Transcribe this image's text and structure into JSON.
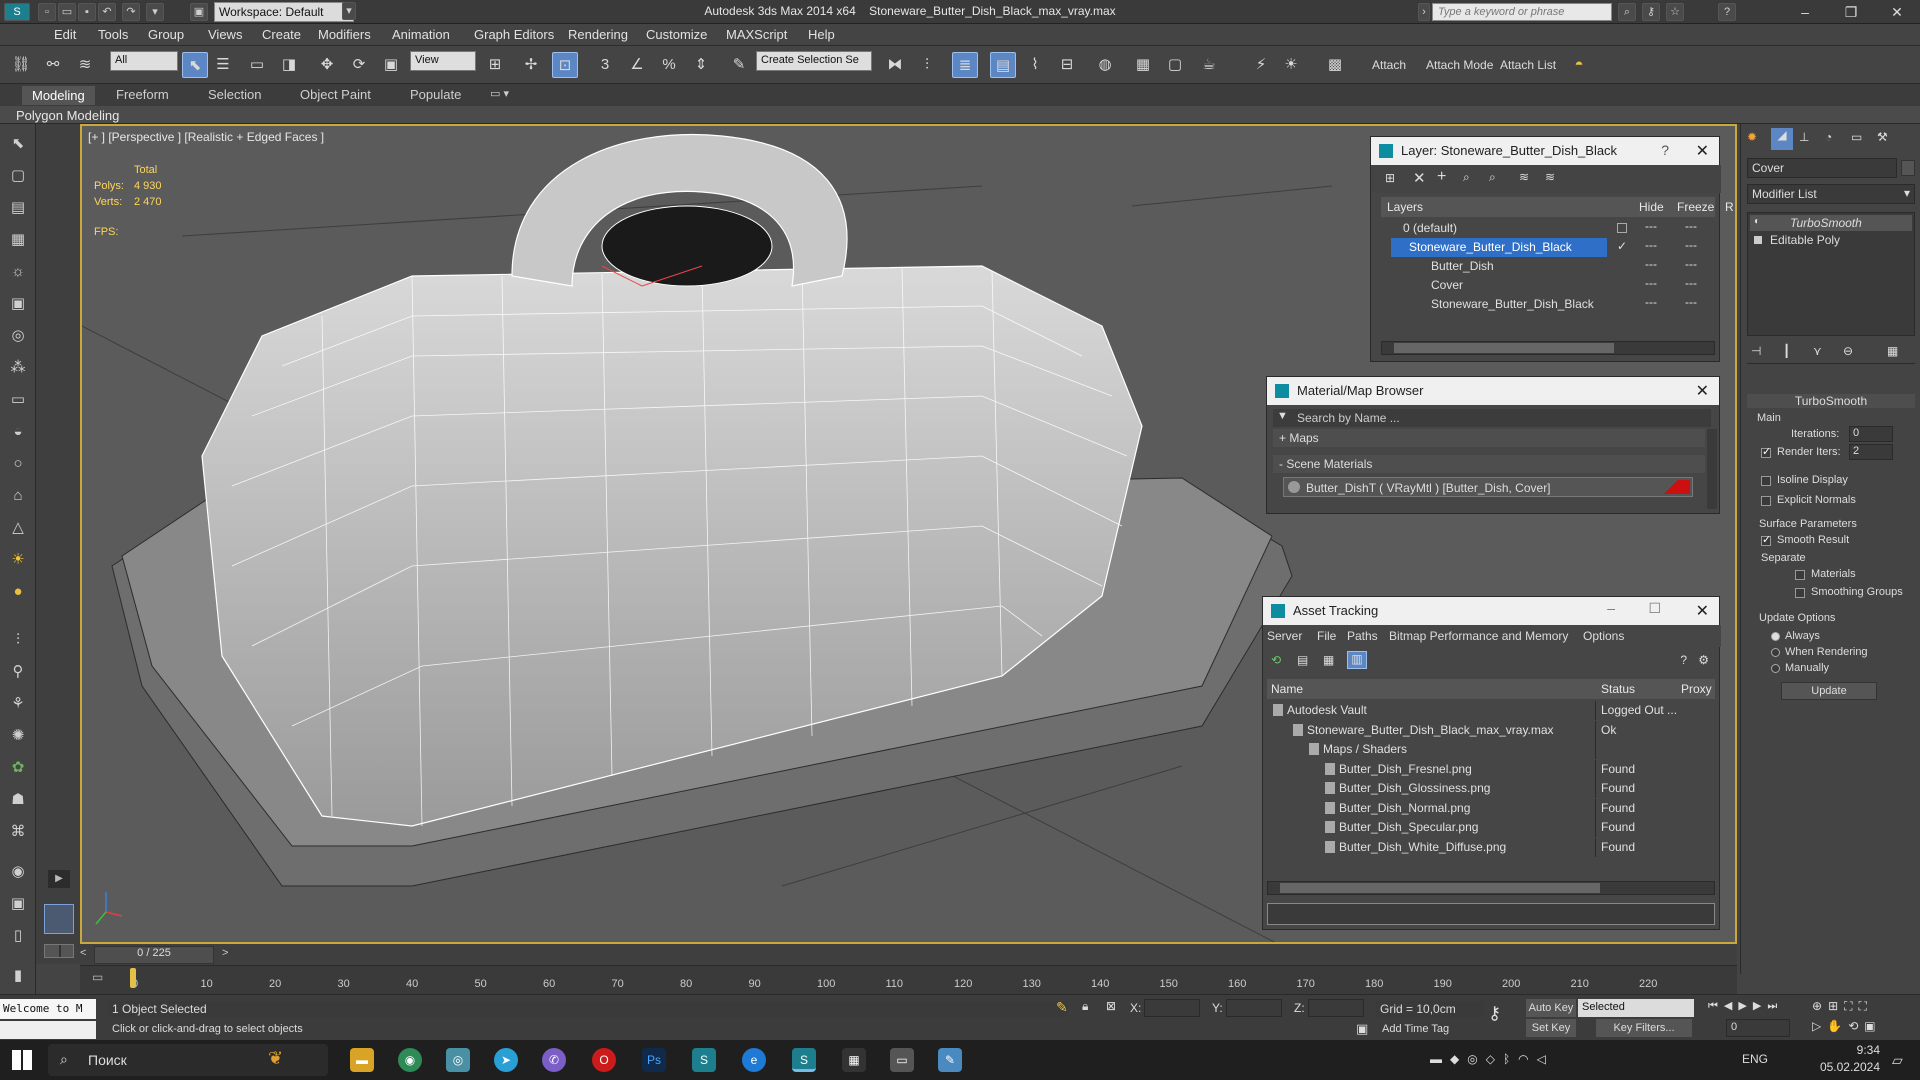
{
  "window": {
    "app_title": "Autodesk 3ds Max  2014 x64",
    "file_title": "Stoneware_Butter_Dish_Black_max_vray.max",
    "workspace": "Workspace: Default",
    "search_placeholder": "Type a keyword or phrase"
  },
  "menu": [
    "Edit",
    "Tools",
    "Group",
    "Views",
    "Create",
    "Modifiers",
    "Animation",
    "Graph Editors",
    "Rendering",
    "Customize",
    "MAXScript",
    "Help"
  ],
  "toolbar": {
    "selection_filter": "All",
    "ref_coord": "View",
    "named_selection": "Create Selection Se",
    "attach_label": "Attach",
    "attach_mode_label": "Attach Mode",
    "attach_list_label": "Attach List"
  },
  "ribbon": {
    "tabs": [
      "Modeling",
      "Freeform",
      "Selection",
      "Object Paint",
      "Populate"
    ],
    "subtitle": "Polygon Modeling"
  },
  "viewport": {
    "label": "[+ ] [Perspective ] [Realistic + Edged Faces ]",
    "stats_total": "Total",
    "polys_label": "Polys:",
    "polys_value": "4 930",
    "verts_label": "Verts:",
    "verts_value": "2 470",
    "fps_label": "FPS:"
  },
  "layer_panel": {
    "title": "Layer: Stoneware_Butter_Dish_Black",
    "col_layers": "Layers",
    "col_hide": "Hide",
    "col_freeze": "Freeze",
    "col_r": "R",
    "rows": [
      "0 (default)",
      "Stoneware_Butter_Dish_Black",
      "Butter_Dish",
      "Cover",
      "Stoneware_Butter_Dish_Black"
    ]
  },
  "material_browser": {
    "title": "Material/Map Browser",
    "search_placeholder": "Search by Name ...",
    "maps_label": "+ Maps",
    "scene_materials_label": "- Scene Materials",
    "material_item": "Butter_DishT  ( VRayMtl )  [Butter_Dish, Cover]",
    "swatch_color": "#cc1010"
  },
  "asset_tracking": {
    "title": "Asset Tracking",
    "menu": [
      "Server",
      "File",
      "Paths",
      "Bitmap Performance and Memory",
      "Options"
    ],
    "col_name": "Name",
    "col_status": "Status",
    "col_proxy": "Proxy",
    "rows": [
      {
        "name": "Autodesk Vault",
        "status": "Logged Out ..."
      },
      {
        "name": "Stoneware_Butter_Dish_Black_max_vray.max",
        "status": "Ok"
      },
      {
        "name": "Maps / Shaders",
        "status": ""
      },
      {
        "name": "Butter_Dish_Fresnel.png",
        "status": "Found"
      },
      {
        "name": "Butter_Dish_Glossiness.png",
        "status": "Found"
      },
      {
        "name": "Butter_Dish_Normal.png",
        "status": "Found"
      },
      {
        "name": "Butter_Dish_Specular.png",
        "status": "Found"
      },
      {
        "name": "Butter_Dish_White_Diffuse.png",
        "status": "Found"
      }
    ]
  },
  "command_panel": {
    "object_name": "Cover",
    "modifier_list": "Modifier List",
    "stack": [
      "TurboSmooth",
      "Editable Poly"
    ],
    "rollout_title": "TurboSmooth",
    "main_label": "Main",
    "iterations_label": "Iterations:",
    "iterations_value": "0",
    "render_iters_label": "Render Iters:",
    "render_iters_value": "2",
    "isoline_label": "Isoline Display",
    "explicit_normals_label": "Explicit Normals",
    "surface_params_label": "Surface Parameters",
    "smooth_result_label": "Smooth Result",
    "separate_label": "Separate",
    "materials_label": "Materials",
    "smoothing_groups_label": "Smoothing Groups",
    "update_options_label": "Update Options",
    "always_label": "Always",
    "when_rendering_label": "When Rendering",
    "manually_label": "Manually",
    "update_button": "Update"
  },
  "timeline": {
    "frame_label": "0 / 225",
    "ticks": [
      "0",
      "10",
      "20",
      "30",
      "40",
      "50",
      "60",
      "70",
      "80",
      "90",
      "100",
      "110",
      "120",
      "130",
      "140",
      "150",
      "160",
      "170",
      "180",
      "190",
      "200",
      "210",
      "220"
    ]
  },
  "status": {
    "listener": "Welcome to M",
    "selected": "1 Object Selected",
    "prompt": "Click or click-and-drag to select objects",
    "x_label": "X:",
    "y_label": "Y:",
    "z_label": "Z:",
    "grid": "Grid = 10,0cm",
    "add_time_tag": "Add Time Tag",
    "auto_key": "Auto Key",
    "auto_key_mode": "Selected",
    "set_key": "Set Key",
    "key_filters": "Key Filters...",
    "frame_value": "0"
  },
  "taskbar": {
    "search": "Поиск",
    "lang": "ENG",
    "time": "9:34",
    "date": "05.02.2024"
  }
}
